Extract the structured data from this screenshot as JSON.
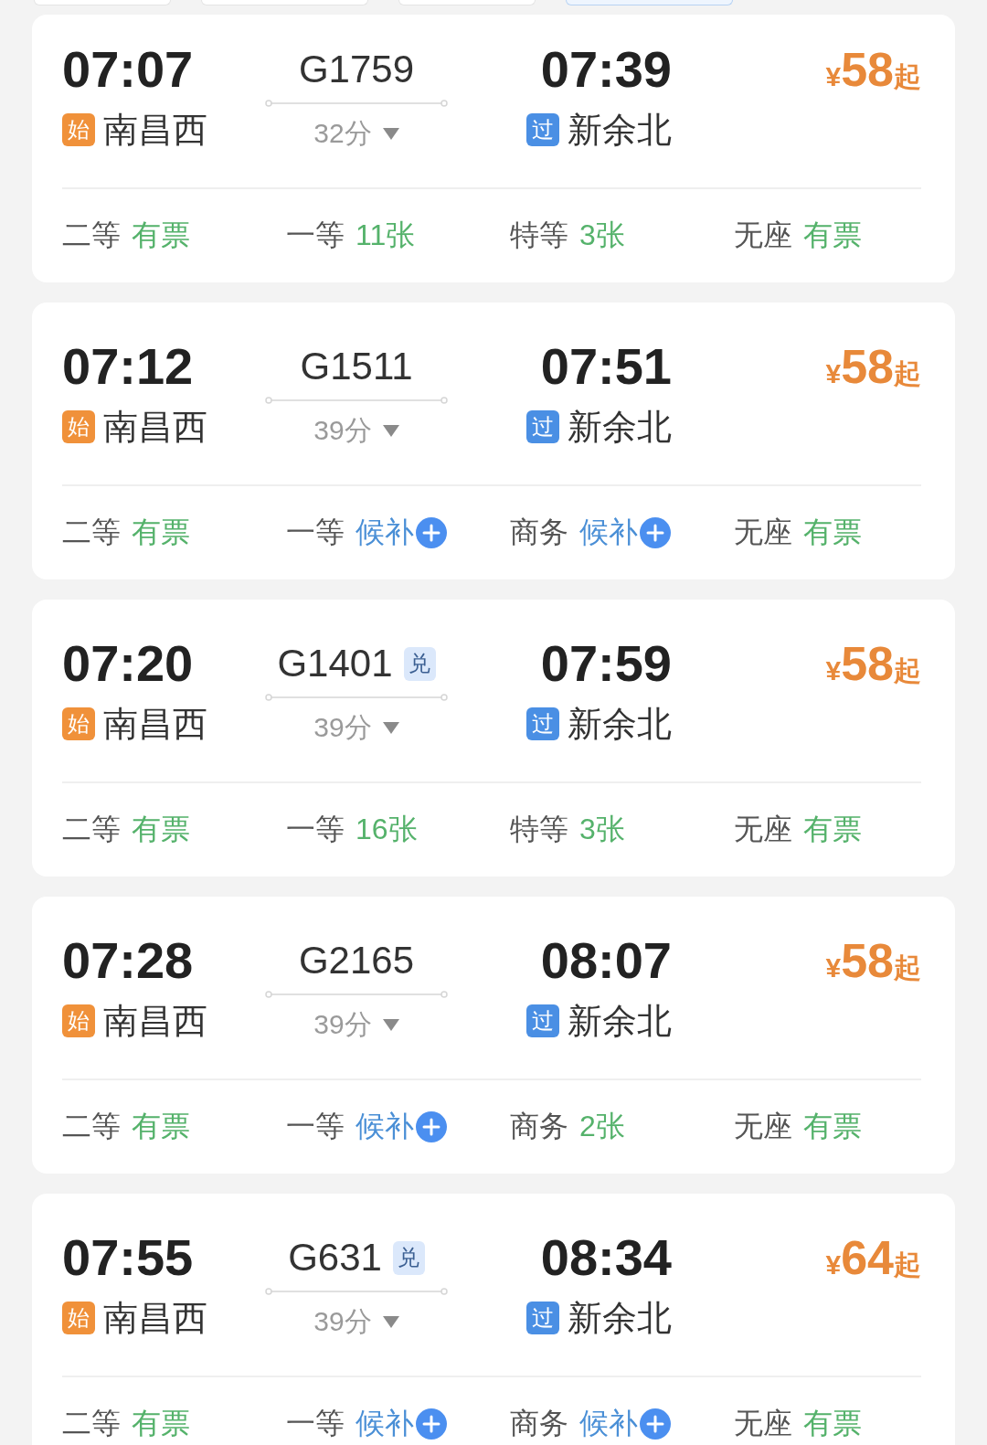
{
  "filter_chips": [
    {
      "selected": false
    },
    {
      "selected": false
    },
    {
      "selected": false
    },
    {
      "selected": true
    }
  ],
  "trains": [
    {
      "depart_time": "07:07",
      "origin_badge": "始",
      "origin": "南昌西",
      "train_no": "G1759",
      "duration": "32分",
      "arrive_time": "07:39",
      "dest_badge": "过",
      "destination": "新余北",
      "price_currency": "¥",
      "price": "58",
      "price_suffix": "起",
      "seats": [
        {
          "class": "二等",
          "status": "有票",
          "kind": "available"
        },
        {
          "class": "一等",
          "status": "11张",
          "kind": "available"
        },
        {
          "class": "特等",
          "status": "3张",
          "kind": "available"
        },
        {
          "class": "无座",
          "status": "有票",
          "kind": "available"
        }
      ]
    },
    {
      "depart_time": "07:12",
      "origin_badge": "始",
      "origin": "南昌西",
      "train_no": "G1511",
      "duration": "39分",
      "arrive_time": "07:51",
      "dest_badge": "过",
      "destination": "新余北",
      "price_currency": "¥",
      "price": "58",
      "price_suffix": "起",
      "seats": [
        {
          "class": "二等",
          "status": "有票",
          "kind": "available"
        },
        {
          "class": "一等",
          "status": "候补",
          "kind": "waitlist"
        },
        {
          "class": "商务",
          "status": "候补",
          "kind": "waitlist"
        },
        {
          "class": "无座",
          "status": "有票",
          "kind": "available"
        }
      ]
    },
    {
      "depart_time": "07:20",
      "origin_badge": "始",
      "origin": "南昌西",
      "train_no": "G1401",
      "badge": "兑",
      "duration": "39分",
      "arrive_time": "07:59",
      "dest_badge": "过",
      "destination": "新余北",
      "price_currency": "¥",
      "price": "58",
      "price_suffix": "起",
      "seats": [
        {
          "class": "二等",
          "status": "有票",
          "kind": "available"
        },
        {
          "class": "一等",
          "status": "16张",
          "kind": "available"
        },
        {
          "class": "特等",
          "status": "3张",
          "kind": "available"
        },
        {
          "class": "无座",
          "status": "有票",
          "kind": "available"
        }
      ]
    },
    {
      "depart_time": "07:28",
      "origin_badge": "始",
      "origin": "南昌西",
      "train_no": "G2165",
      "duration": "39分",
      "arrive_time": "08:07",
      "dest_badge": "过",
      "destination": "新余北",
      "price_currency": "¥",
      "price": "58",
      "price_suffix": "起",
      "seats": [
        {
          "class": "二等",
          "status": "有票",
          "kind": "available"
        },
        {
          "class": "一等",
          "status": "候补",
          "kind": "waitlist"
        },
        {
          "class": "商务",
          "status": "2张",
          "kind": "available"
        },
        {
          "class": "无座",
          "status": "有票",
          "kind": "available"
        }
      ]
    },
    {
      "depart_time": "07:55",
      "origin_badge": "始",
      "origin": "南昌西",
      "train_no": "G631",
      "badge": "兑",
      "duration": "39分",
      "arrive_time": "08:34",
      "dest_badge": "过",
      "destination": "新余北",
      "price_currency": "¥",
      "price": "64",
      "price_suffix": "起",
      "seats": [
        {
          "class": "二等",
          "status": "有票",
          "kind": "available"
        },
        {
          "class": "一等",
          "status": "候补",
          "kind": "waitlist"
        },
        {
          "class": "商务",
          "status": "候补",
          "kind": "waitlist"
        },
        {
          "class": "无座",
          "status": "有票",
          "kind": "available"
        }
      ]
    }
  ]
}
